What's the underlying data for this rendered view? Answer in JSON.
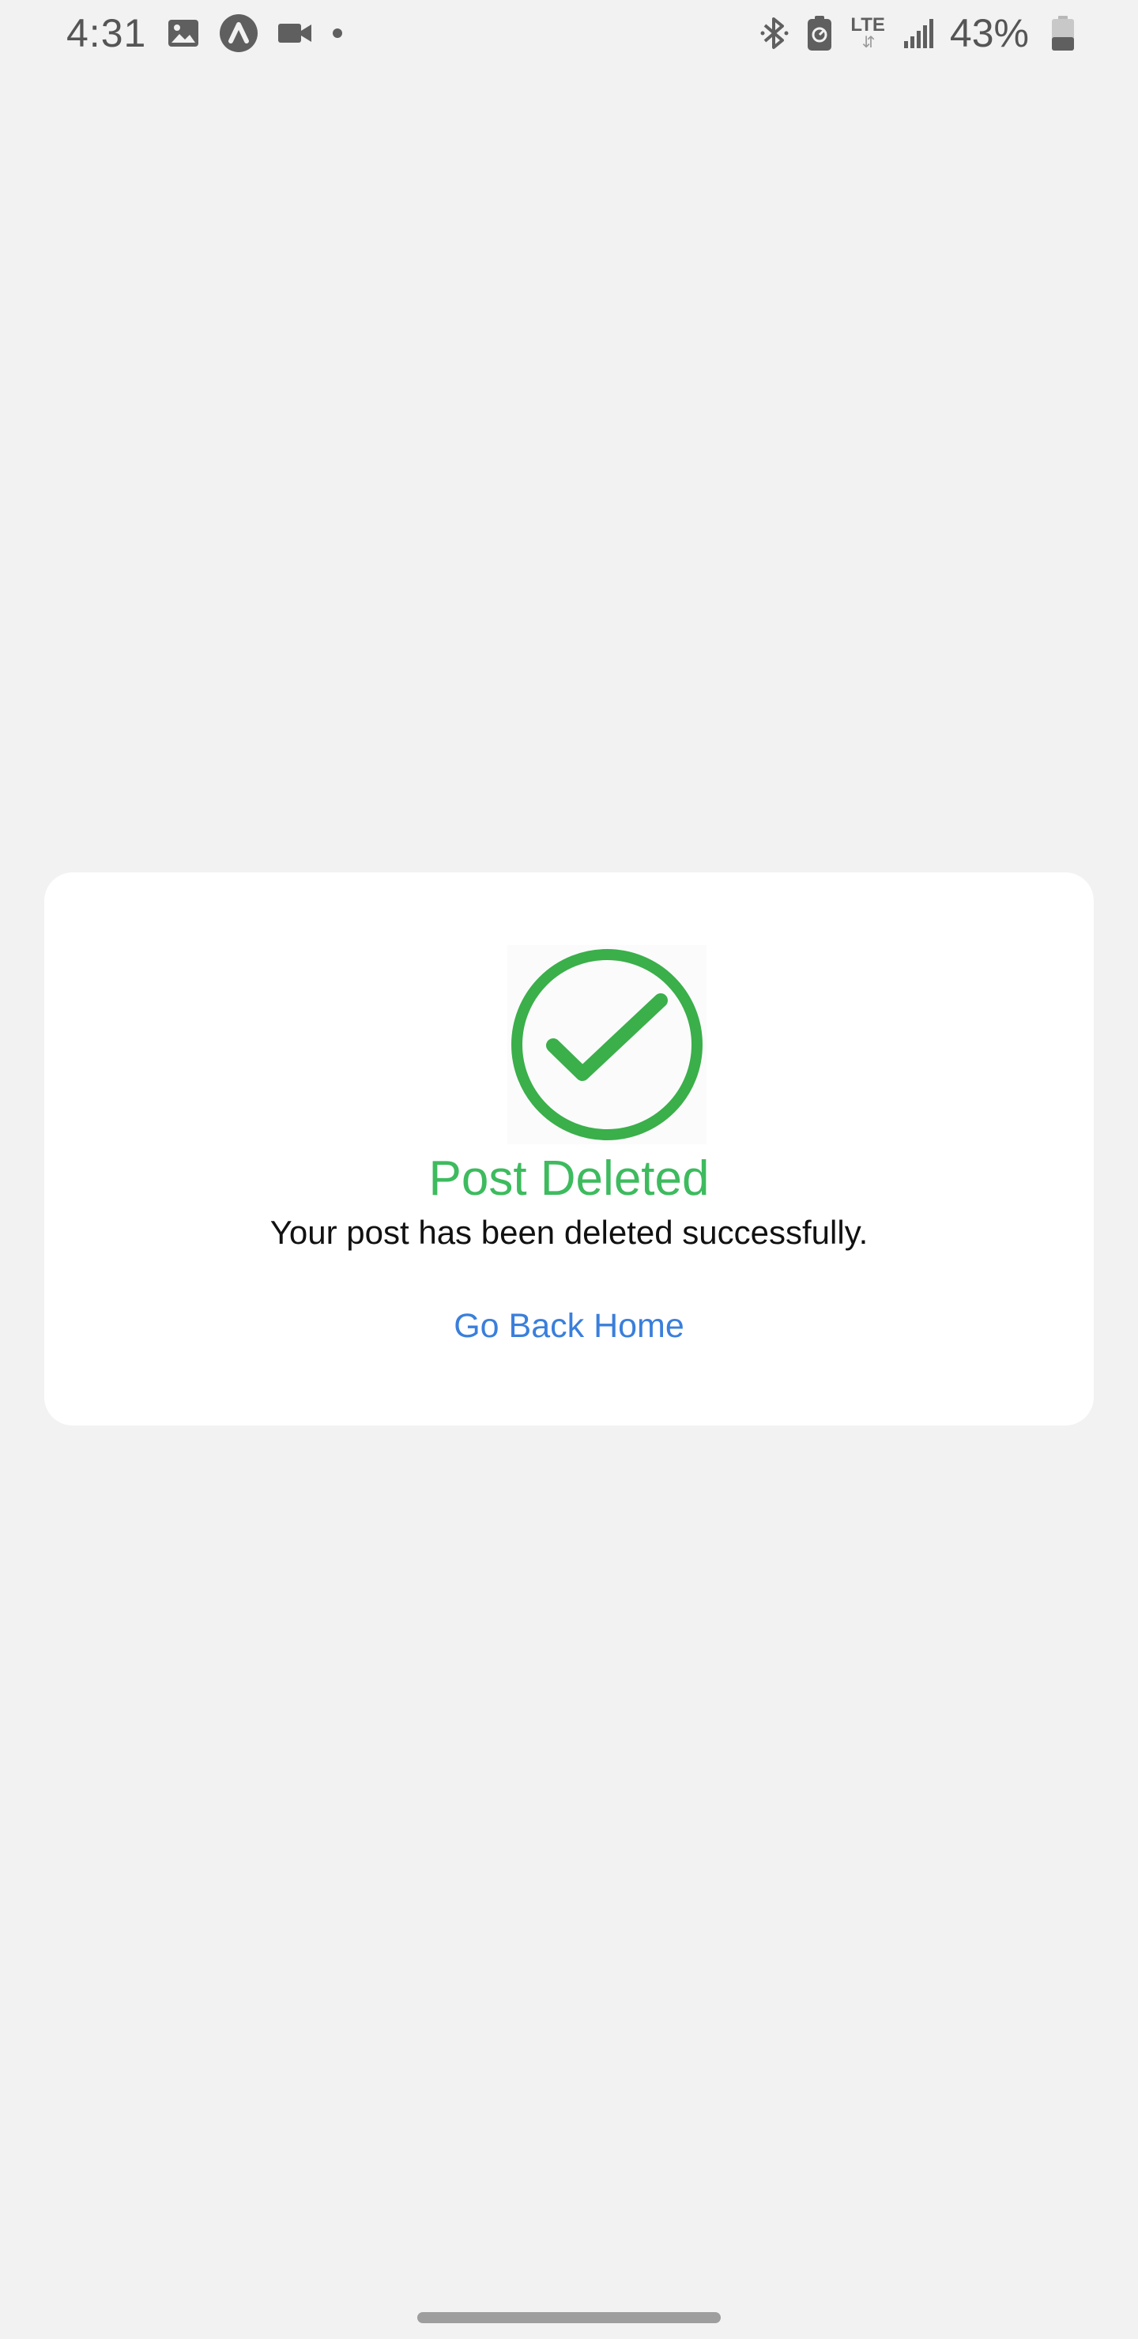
{
  "status_bar": {
    "time": "4:31",
    "left_icons": [
      "gallery-icon",
      "app-notification-icon",
      "video-camera-icon",
      "dot-icon"
    ],
    "right_icons": [
      "bluetooth-icon",
      "battery-saver-icon",
      "lte-icon",
      "signal-icon",
      "battery-icon"
    ],
    "network": "LTE",
    "battery_percent": "43%",
    "battery_level": 0.43
  },
  "dialog": {
    "icon": "check-circle-icon",
    "title": "Post Deleted",
    "message": "Your post has been deleted successfully.",
    "action_label": "Go Back Home"
  },
  "colors": {
    "background": "#f2f2f2",
    "card": "#ffffff",
    "success_green": "#3dbb5e",
    "check_green": "#3aaf4a",
    "link_blue": "#3a7fdb"
  }
}
